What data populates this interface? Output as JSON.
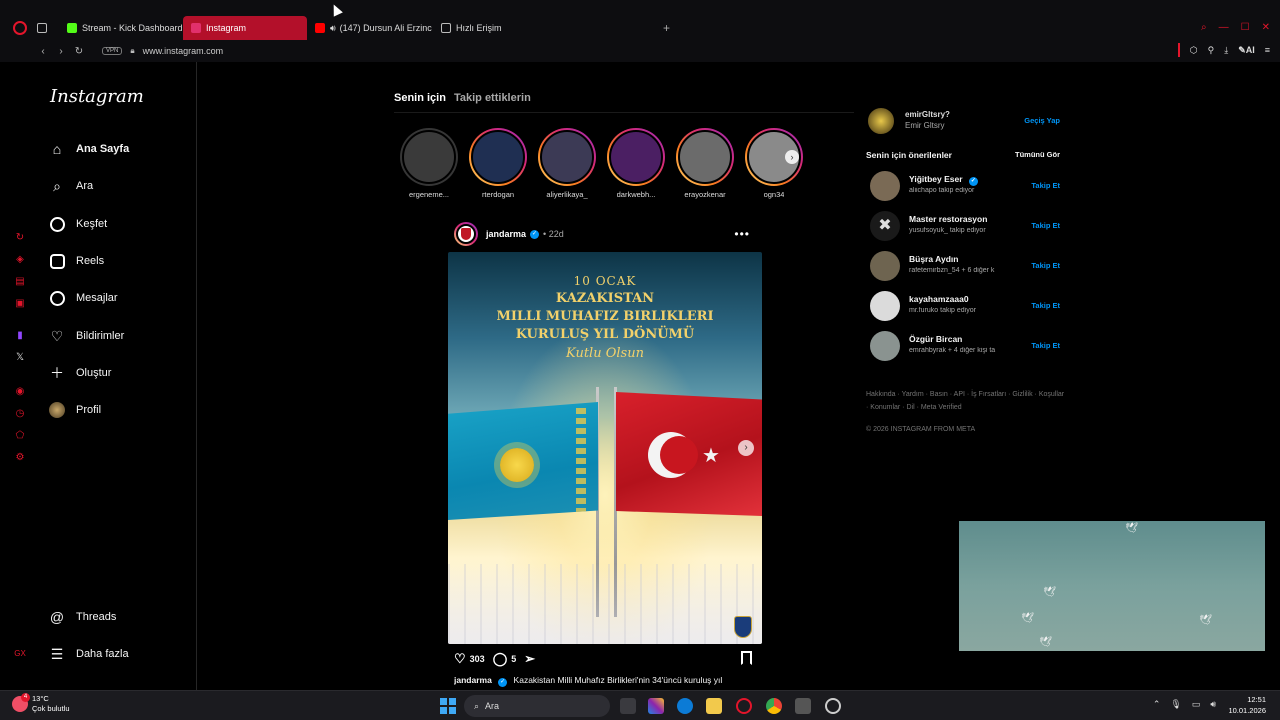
{
  "browser": {
    "tabs": [
      {
        "label": "Stream - Kick Dashboard",
        "icon": "kick-icon",
        "color": "#53fc18"
      },
      {
        "label": "Instagram",
        "icon": "instagram-icon",
        "color": "#e1306c",
        "active": true
      },
      {
        "label": "(147) Dursun Ali Erzinc",
        "icon": "youtube-icon",
        "color": "#ff0000"
      },
      {
        "label": "Hızlı Erişim",
        "icon": "grid-icon",
        "color": "#bbbbbb"
      }
    ],
    "url": "www.instagram.com",
    "vpn_label": "VPN",
    "ai_label": "AI",
    "accent": "#e3152b"
  },
  "instagram": {
    "logo": "Instagram",
    "nav": [
      {
        "label": "Ana Sayfa",
        "icon": "home-icon"
      },
      {
        "label": "Ara",
        "icon": "search-icon"
      },
      {
        "label": "Keşfet",
        "icon": "compass-icon"
      },
      {
        "label": "Reels",
        "icon": "reels-icon"
      },
      {
        "label": "Mesajlar",
        "icon": "messenger-icon"
      },
      {
        "label": "Bildirimler",
        "icon": "heart-icon"
      },
      {
        "label": "Oluştur",
        "icon": "plus-icon"
      },
      {
        "label": "Profil",
        "icon": "avatar"
      }
    ],
    "nav_bottom": [
      {
        "label": "Threads",
        "icon": "threads-icon"
      },
      {
        "label": "Daha fazla",
        "icon": "menu-icon"
      }
    ],
    "feed_tabs": {
      "for_you": "Senin için",
      "following": "Takip ettiklerin"
    },
    "stories": [
      {
        "name": "ergeneme...",
        "seen": true,
        "color": "#3a3a3a"
      },
      {
        "name": "rterdogan",
        "seen": false,
        "color": "#1f2f52"
      },
      {
        "name": "aliyerlikaya_",
        "seen": false,
        "color": "#3c3a55"
      },
      {
        "name": "darkwebh...",
        "seen": false,
        "color": "#4b1f63"
      },
      {
        "name": "erayozkenar",
        "seen": false,
        "color": "#6b6b6b"
      },
      {
        "name": "ogn34",
        "seen": false,
        "color": "#8a8a8a"
      }
    ],
    "post": {
      "user": "jandarma",
      "time": "22d",
      "poster_line1": "10 OCAK",
      "poster_line2": "KAZAKISTAN",
      "poster_line3": "MILLI MUHAFIZ BIRLIKLERI",
      "poster_line4": "KURULUŞ YIL DÖNÜMÜ",
      "poster_line5": "Kutlu Olsun",
      "likes": "303",
      "comments": "5",
      "caption_user": "jandarma",
      "caption_text": "Kazakistan Milli Muhafız Birlikleri'nin 34'üncü kuruluş yıl"
    },
    "me": {
      "name": "emirGltsry?",
      "sub": "Emir Gltsry",
      "switch": "Geçiş Yap"
    },
    "suggestions_title": "Senin için önerilenler",
    "see_all": "Tümünü Gör",
    "suggestions": [
      {
        "name": "Yiğitbey Eser",
        "verified": true,
        "sub": "aliichapo takip ediyor",
        "follow": "Takip Et",
        "color": "#7a6a55"
      },
      {
        "name": "Master restorasyon",
        "verified": false,
        "sub": "yusufsoyuk_ takip ediyor",
        "follow": "Takip Et",
        "color": "#1a1a1a"
      },
      {
        "name": "Büşra Aydın",
        "verified": false,
        "sub": "rafetemirbzn_54 + 6 diğer k",
        "follow": "Takip Et",
        "color": "#6e6450"
      },
      {
        "name": "kayahamzaaa0",
        "verified": false,
        "sub": "mr.furuko takip ediyor",
        "follow": "Takip Et",
        "color": "#dbdbdb"
      },
      {
        "name": "Özgür Bircan",
        "verified": false,
        "sub": "emrahbyrak + 4 diğer kişi ta",
        "follow": "Takip Et",
        "color": "#8a9390"
      }
    ],
    "footer_links": "Hakkında · Yardım · Basın · API · İş Fırsatları · Gizlilik · Koşullar · Konumlar · Dil · Meta Verified",
    "copyright": "© 2026 INSTAGRAM FROM META"
  },
  "taskbar": {
    "temp": "13°C",
    "weather": "Çok bulutlu",
    "weather_badge": "4",
    "search": "Ara",
    "time": "12:51",
    "date": "10.01.2026"
  }
}
